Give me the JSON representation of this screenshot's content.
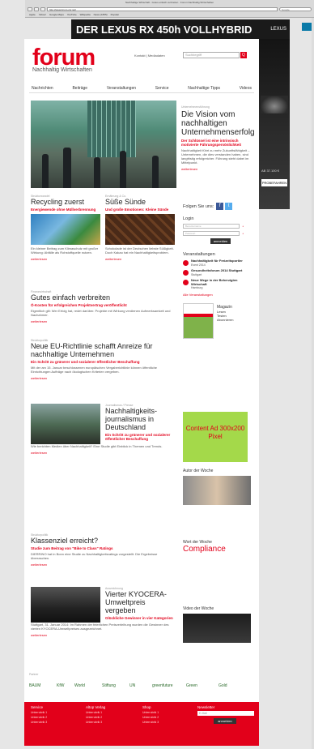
{
  "browser": {
    "window_title": "Nachhaltige Wirtschaft - Gutes einfach verbreiten · Forum Nachhaltig Wirtschaften",
    "url": "http://www.forum-csr.net/",
    "search_placeholder": "Google",
    "bookmarks": [
      "Apple",
      "Yahoo!",
      "Google Maps",
      "YouTube",
      "Wikipedia",
      "News (1655)",
      "Popular"
    ]
  },
  "ads": {
    "banner_text": "DER LEXUS RX 450h VOLLHYBRID",
    "banner_brand": "LEXUS",
    "skyscraper_price": "AB 37.100 €",
    "skyscraper_cta": "PROBEFAHREN",
    "content_ad": "Content Ad 300x200 Pixel"
  },
  "site": {
    "logo": "forum",
    "tagline": "Nachhaltig Wirtschaften",
    "top_links": "Kontakt | Mediadaten",
    "search_placeholder": "Suchbegriff",
    "search_btn": "Q"
  },
  "nav": [
    "Nachrichten",
    "Beiträge",
    "Veranstaltungen",
    "Service",
    "Nachhaltige Tipps",
    "Videos"
  ],
  "hero": {
    "category": "Unternehmensführung",
    "title": "Die Vision vom nachhaltigen Unternehmenserfolg",
    "subtitle": "Der Schlüssel ist eine intrinsisch motivierte Führungspersönlichkeit",
    "body": "Nachhaltigkeit führt zu mehr Zukunftsfähigkeit – Unternehmen, die dies verstanden haben, sind langfristig erfolgreicher. Führung steht dabei im Mittelpunkt.",
    "more": "weiterlesen"
  },
  "articles": [
    {
      "category": "Strukturwandel",
      "title": "Recycling zuerst",
      "subtitle": "Energiewende ohne Müllverbrennung",
      "body": "Ein kleiner Beitrag zum Klimaschutz mit großer Wirkung: Abfälle als Rohstoffquelle nutzen.",
      "more": "weiterlesen"
    },
    {
      "category": "Ernährung & Co.",
      "title": "Süße Sünde",
      "subtitle": "Und große Emotionen: Kleine Sünde",
      "body": "Schokolade ist der Deutschen liebste Süßigkeit. Doch Kakao hat ein Nachhaltigkeitsproblem.",
      "more": "weiterlesen"
    },
    {
      "category": "Finanzwirtschaft",
      "title": "Gutes einfach verbreiten",
      "subtitle": "Ö-Kosten für erfolgreichen Projektvertrag veröffentlicht",
      "body": "Eigentlich gilt: Wer Erfolg hat, redet darüber. Projekte mit Wirkung verdienen Aufmerksamkeit und Nachahmer.",
      "more": "weiterlesen"
    },
    {
      "category": "Strukturpolitik",
      "title": "Neue EU-Richtlinie schafft Anreize für nachhaltige Unternehmen",
      "subtitle": "Ein Schritt zu grünerer und sozialerer öffentlicher Beschaffung",
      "body": "Mit der am 15. Januar beschlossenen europäischen Vergaberichtlinie können öffentliche Einrichtungen Aufträge nach ökologischen Kriterien vergeben.",
      "more": "weiterlesen"
    },
    {
      "category": "Journalismus / Presse",
      "title": "Nachhaltigkeits-journalismus in Deutschland",
      "subtitle": "Ein Schritt zu grünerer und sozialerer öffentlicher Beschaffung",
      "body": "Wie berichten Medien über Nachhaltigkeit? Eine Studie gibt Einblick in Themen und Trends.",
      "more": "weiterlesen"
    },
    {
      "category": "Strukturpolitik",
      "title": "Klassenziel erreicht?",
      "subtitle": "Studie zum Beitrag von \"Bike to Class\" Ratings",
      "body": "DIERRINO hat in Bonn eine Studie zu Nachhaltigkeitsratings vorgestellt. Die Ergebnisse überraschen.",
      "more": "weiterlesen"
    },
    {
      "category": "Auszeichnung",
      "title": "Vierter KYOCERA-Umweltpreis vergeben",
      "subtitle": "Glückliche Gewinner in vier Kategorien",
      "body": "Stuttgart, 31. Januar 2014: Im Rahmen der feierlichen Preisverleihung wurden die Gewinner des vierten KYOCERA-Umweltpreises ausgezeichnet.",
      "more": "weiterlesen"
    }
  ],
  "sidebar": {
    "follow": "Folgen Sie uns:",
    "login_title": "Login",
    "login_user": "Benutzername",
    "login_pass": "Passwort",
    "login_btn": "anmelden",
    "events_title": "Veranstaltungen",
    "events": [
      {
        "title": "Nachhaltigkeit für Freizeitsportler",
        "text": "Event 2014"
      },
      {
        "title": "Gesundheitsforum 2014 Stuttgart",
        "text": "Stuttgart"
      },
      {
        "title": "Neue Wege in der Beherzigten Wirtschaft",
        "text": "Hamburg"
      }
    ],
    "all_events": "Alle Veranstaltungen",
    "magazine_title": "Magazin",
    "magazine_items": [
      "Lesen",
      "Testen",
      "Abonnieren"
    ],
    "word_title": "Wort der Woche",
    "word": "Compliance",
    "author_title": "Autor der Woche",
    "video_title": "Video der Woche"
  },
  "partners": {
    "title": "Partner",
    "logos": [
      "BAUM",
      "KfW",
      "World",
      "Stiftung",
      "UN",
      "greenfuture",
      "Green",
      "Gold"
    ]
  },
  "footer": [
    {
      "title": "Service",
      "items": [
        "Unterrubrik 1",
        "Unterrubrik 2",
        "Unterrubrik 3"
      ]
    },
    {
      "title": "Altop Verlag",
      "items": [
        "Unterrubrik 1",
        "Unterrubrik 2",
        "Unterrubrik 3"
      ]
    },
    {
      "title": "Shop",
      "items": [
        "Unterrubrik 1",
        "Unterrubrik 2",
        "Unterrubrik 3"
      ]
    },
    {
      "title": "Newsletter",
      "items": [
        "E-Mail",
        "anmelden"
      ]
    }
  ]
}
